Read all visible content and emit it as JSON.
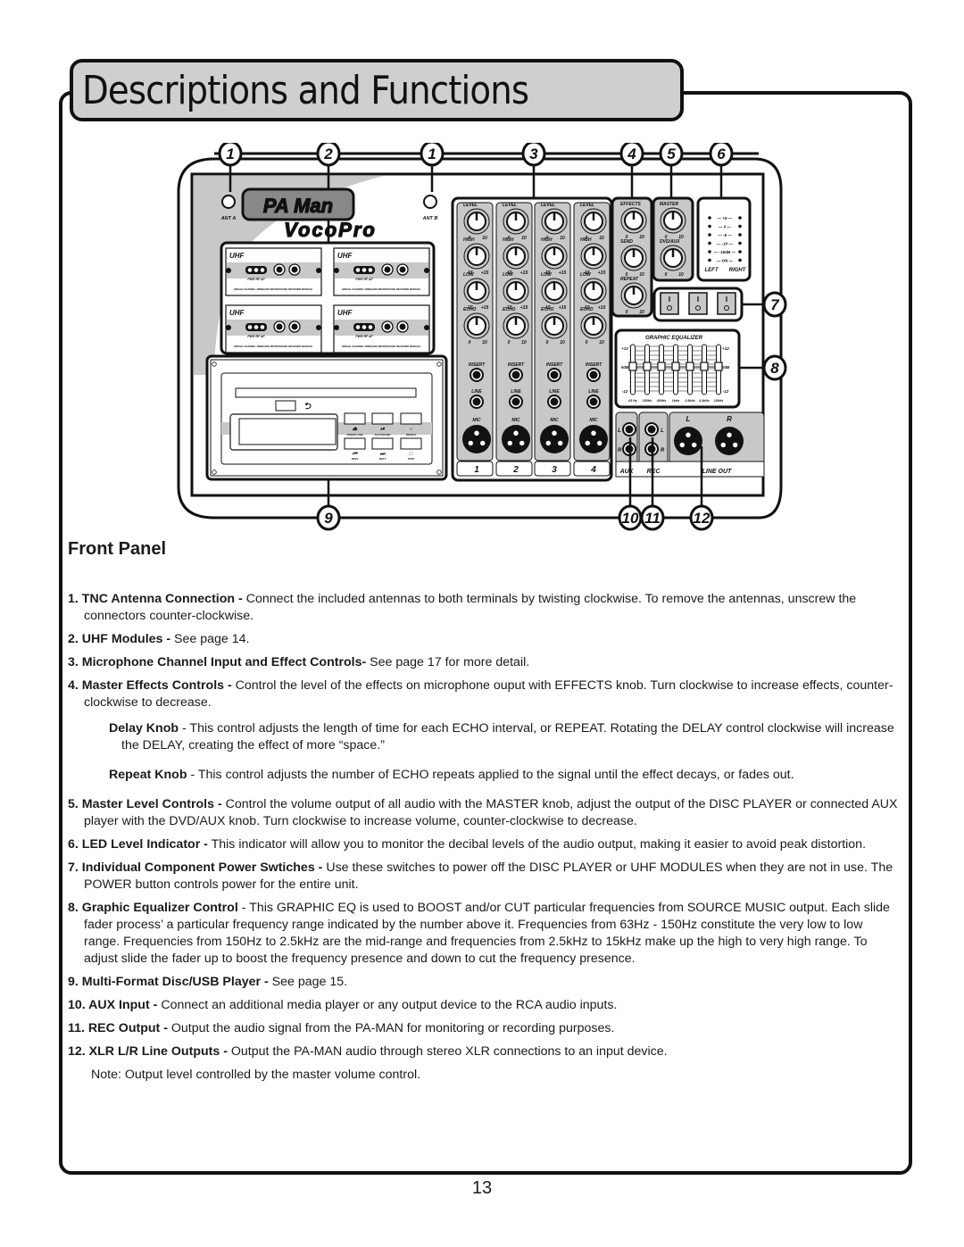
{
  "page": {
    "title": "Descriptions and Functions",
    "section_title": "Front Panel",
    "page_number": "13"
  },
  "diagram": {
    "callouts_top": [
      "1",
      "2",
      "1",
      "3",
      "4",
      "5",
      "6"
    ],
    "callouts_right": [
      "7",
      "8"
    ],
    "callouts_bottom": [
      "9",
      "10",
      "11",
      "12"
    ],
    "brand": "PA Man",
    "sub_brand": "VocoPro",
    "antennas": [
      "ANT A",
      "ANT B"
    ],
    "uhf_modules": [
      {
        "label": "UHF",
        "caption": "SINGLE CHANNEL WIRELESS MICROPHONE RECEIVER MODULE",
        "leds": "PWR RF AF",
        "knobs": [
          "SQ",
          "MIN  MAX"
        ]
      },
      {
        "label": "UHF",
        "caption": "SINGLE CHANNEL WIRELESS MICROPHONE RECEIVER MODULE",
        "leds": "PWR RF AF",
        "knobs": [
          "SQ",
          "MIN  MAX"
        ]
      },
      {
        "label": "UHF",
        "caption": "SINGLE CHANNEL WIRELESS MICROPHONE RECEIVER MODULE",
        "leds": "PWR RF AF",
        "knobs": [
          "SQ",
          "MIN  MAX"
        ]
      },
      {
        "label": "UHF",
        "caption": "SINGLE CHANNEL WIRELESS MICROPHONE RECEIVER MODULE",
        "leds": "PWR RF AF",
        "knobs": [
          "SQ",
          "MIN  MAX"
        ]
      }
    ],
    "disc_player": {
      "buttons_top": [
        "OPEN/CLOSE",
        "PLAY/PAUSE",
        "REPEAT"
      ],
      "buttons_bottom": [
        "PREV",
        "NEXT",
        "STOP"
      ]
    },
    "channels": {
      "numbers": [
        "1",
        "2",
        "3",
        "4"
      ],
      "knobs": [
        {
          "label": "LEVEL",
          "min": "0",
          "max": "10"
        },
        {
          "label": "HIGH",
          "min": "-15",
          "max": "+15"
        },
        {
          "label": "LOW",
          "min": "-15",
          "max": "+15"
        },
        {
          "label": "ECHO",
          "min": "0",
          "max": "10"
        }
      ],
      "jacks": [
        "INSERT",
        "LINE",
        "MIC"
      ]
    },
    "effects_knobs": [
      {
        "label": "EFFECTS",
        "min": "0",
        "max": "10"
      },
      {
        "label": "SEND",
        "min": "0",
        "max": "10"
      },
      {
        "label": "REPEAT",
        "min": "0",
        "max": "10"
      }
    ],
    "master_knobs": [
      {
        "label": "MASTER",
        "min": "0",
        "max": "10"
      },
      {
        "label": "DVD/AUX",
        "min": "0",
        "max": "10"
      }
    ],
    "led_meter": {
      "levels": [
        "+5",
        "0",
        "-5",
        "-10",
        "-15dB",
        "ON"
      ],
      "left": "LEFT",
      "right": "RIGHT"
    },
    "power_switch_count": 3,
    "equalizer": {
      "title": "GRAPHIC EQUALIZER",
      "scale": [
        "+12",
        "0dB",
        "-12"
      ],
      "bands": [
        "63 Hz",
        "150Hz",
        "400Hz",
        "1kHz",
        "2.5kHz",
        "6.4kHz",
        "15kHz"
      ]
    },
    "outputs": {
      "aux": "AUX",
      "rec": "REC",
      "line_out": "LINE OUT",
      "l": "L",
      "r": "R"
    }
  },
  "items": [
    {
      "num": "1.",
      "term": "TNC Antenna Connection -",
      "text": " Connect the included antennas to both terminals by twisting clockwise. To remove the antennas, unscrew the connectors counter-clockwise."
    },
    {
      "num": "2.",
      "term": "UHF Modules -",
      "text": " See page 14."
    },
    {
      "num": "3.",
      "term": "Microphone Channel Input and Effect Controls-",
      "text": " See page 17 for more detail."
    },
    {
      "num": "4.",
      "term": "Master Effects Controls -",
      "text": " Control the level of the effects on microphone ouput with EFFECTS knob.  Turn clockwise to increase effects, counter-clockwise to decrease.",
      "subitems": [
        {
          "term": "Delay Knob",
          "text": " - This control adjusts the length of time for each ECHO interval, or REPEAT. Rotating the DELAY control clockwise will increase the DELAY, creating the effect of more “space.”"
        },
        {
          "term": "Repeat Knob",
          "text": " - This control adjusts the number of ECHO repeats applied to the signal until the effect decays, or fades out."
        }
      ]
    },
    {
      "num": "5.",
      "term": "Master Level Controls -",
      "text": " Control the volume output of all audio with the MASTER knob, adjust the output of the DISC PLAYER or connected AUX player with the DVD/AUX knob.  Turn clockwise to increase volume, counter-clockwise to decrease."
    },
    {
      "num": "6.",
      "term": "LED Level Indicator -",
      "text": " This indicator will allow you to monitor the decibal levels of the audio output, making it easier to avoid peak distortion."
    },
    {
      "num": "7.",
      "term": "Individual Component Power Swtiches -",
      "text": " Use these switches to power off the DISC PLAYER or UHF MODULES when they are not in use.  The POWER button controls power for the entire unit."
    },
    {
      "num": "8.",
      "term": "Graphic Equalizer Control",
      "text": " - This GRAPHIC EQ is used to BOOST and/or CUT particular frequencies from SOURCE MUSIC output. Each slide fader process’ a particular frequency range indicated by the number above it. Frequencies from 63Hz - 150Hz constitute the very low to low range. Frequencies from 150Hz to 2.5kHz are the mid-range and frequencies from 2.5kHz to 15kHz make up the high to very high range. To adjust slide the fader up to boost the frequency presence and down to cut the frequency presence."
    },
    {
      "num": "9.",
      "term": "Multi-Format Disc/USB Player -",
      "text": " See page 15."
    },
    {
      "num": "10.",
      "term": "AUX Input -",
      "text": " Connect an additional media player or any output device to the RCA audio inputs."
    },
    {
      "num": "11.",
      "term": "REC Output -",
      "text": " Output the audio signal from the PA-MAN for monitoring or recording purposes."
    },
    {
      "num": "12.",
      "term": "XLR L/R Line Outputs -",
      "text": " Output the PA-MAN audio through stereo XLR connections to an input device."
    }
  ],
  "note": "Note: Output level controlled by the master volume control."
}
